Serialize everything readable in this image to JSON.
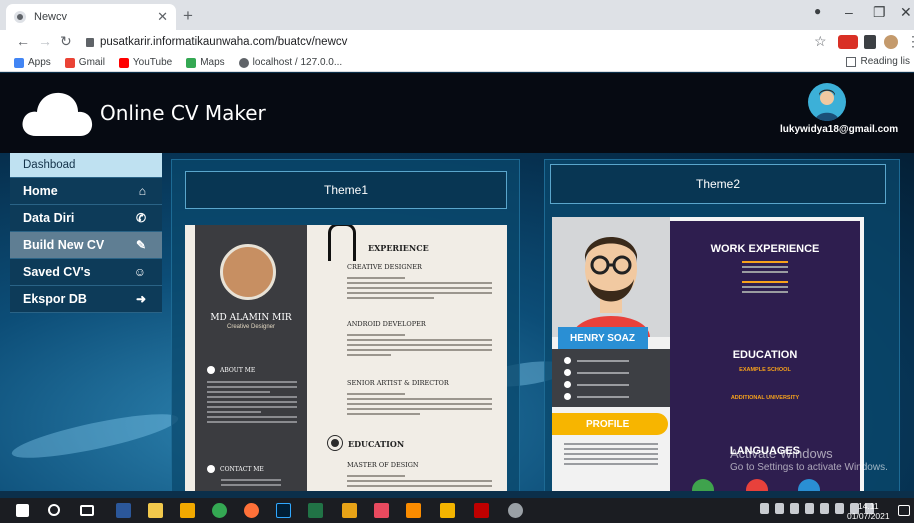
{
  "browser": {
    "tab_title": "Newcv",
    "url": "pusatkarir.informatikaunwaha.com/buatcv/newcv",
    "bookmarks": [
      "Apps",
      "Gmail",
      "YouTube",
      "Maps",
      "localhost / 127.0.0..."
    ],
    "reading_list": "Reading lis"
  },
  "header": {
    "brand": "Online CV Maker",
    "user_email": "lukywidya18@gmail.com"
  },
  "sidebar": {
    "title": "Dashboad",
    "items": [
      {
        "label": "Home",
        "icon": "home-icon"
      },
      {
        "label": "Data Diri",
        "icon": "phone-icon"
      },
      {
        "label": "Build New CV",
        "icon": "edit-icon"
      },
      {
        "label": "Saved CV's",
        "icon": "user-circle-icon"
      },
      {
        "label": "Ekspor DB",
        "icon": "sign-out-icon"
      }
    ]
  },
  "themes": [
    {
      "label": "Theme1"
    },
    {
      "label": "Theme2"
    }
  ],
  "theme1_preview": {
    "name": "MD ALAMIN MIR",
    "title": "Creative Designer",
    "about": "ABOUT ME",
    "contact": "CONTACT ME",
    "experience": "EXPERIENCE",
    "jobs": [
      "CREATIVE DESIGNER",
      "ANDROID DEVELOPER",
      "SENIOR ARTIST & DIRECTOR"
    ],
    "education": "EDUCATION",
    "edu_item": "MASTER OF DESIGN"
  },
  "theme2_preview": {
    "name": "HENRY SOAZ",
    "work_experience": "WORK EXPERIENCE",
    "education": "EDUCATION",
    "example_school": "EXAMPLE SCHOOL",
    "additional_university": "ADDITIONAL UNIVERSITY",
    "profile": "PROFILE",
    "languages": "LANGUAGES"
  },
  "watermark": {
    "line1": "Activate Windows",
    "line2": "Go to Settings to activate Windows."
  },
  "taskbar": {
    "time": "14.11",
    "date": "01/07/2021"
  },
  "colors": {
    "header_bg": "#060a12",
    "sidebar_bg": "#0d3b59",
    "sidebar_active": "#5f7e93",
    "theme2_accent": "#f7b500",
    "theme2_blue": "#2a8fd4"
  }
}
